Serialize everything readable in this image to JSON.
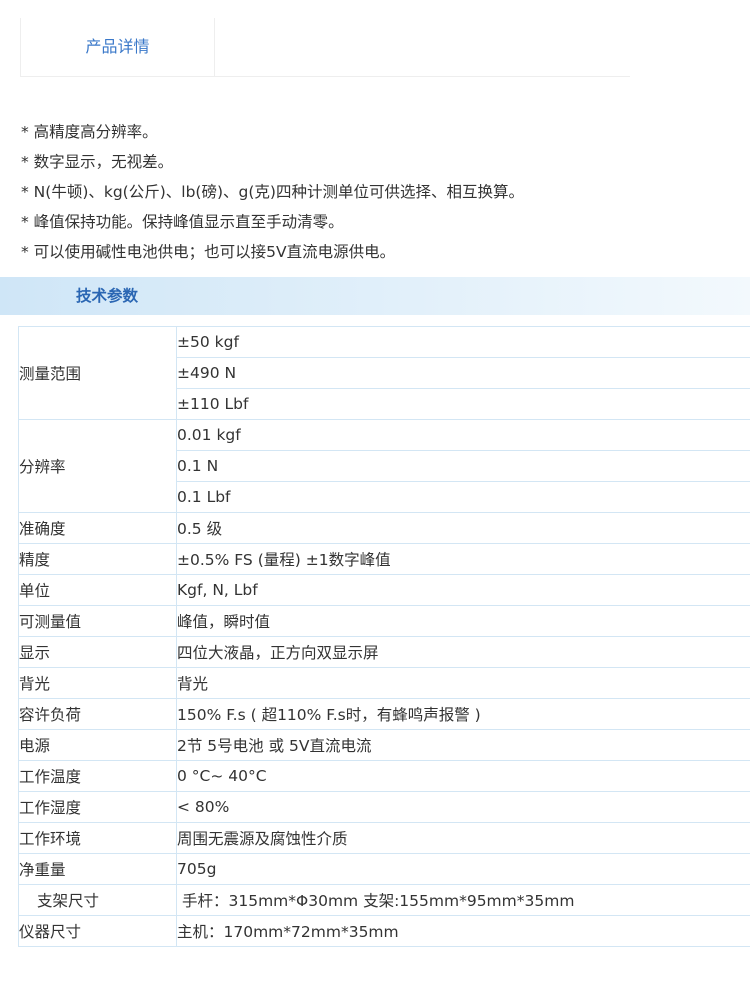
{
  "tabs": {
    "active_label": "产品详情"
  },
  "features": [
    "* 高精度高分辨率。",
    "* 数字显示，无视差。",
    "* N(牛顿)、kg(公斤)、lb(磅)、g(克)四种计测单位可供选择、相互换算。",
    "* 峰值保持功能。保持峰值显示直至手动清零。",
    "* 可以使用碱性电池供电；也可以接5V直流电源供电。"
  ],
  "section": {
    "title": "技术参数"
  },
  "spec_table": {
    "rows": [
      {
        "key": "测量范围",
        "values": [
          "±50 kgf",
          "±490 N",
          "±110 Lbf"
        ]
      },
      {
        "key": "分辨率",
        "values": [
          "0.01 kgf",
          "0.1 N",
          "0.1 Lbf"
        ]
      },
      {
        "key": "准确度",
        "values": [
          "0.5 级"
        ]
      },
      {
        "key": "精度",
        "values": [
          "±0.5% FS (量程) ±1数字峰值"
        ]
      },
      {
        "key": "单位",
        "values": [
          "Kgf, N, Lbf"
        ]
      },
      {
        "key": "可测量值",
        "values": [
          "峰值，瞬时值"
        ]
      },
      {
        "key": "显示",
        "values": [
          "四位大液晶，正方向双显示屏"
        ]
      },
      {
        "key": "背光",
        "values": [
          "背光"
        ]
      },
      {
        "key": "容许负荷",
        "values": [
          "150% F.s ( 超110% F.s时，有蜂鸣声报警 )"
        ]
      },
      {
        "key": "电源",
        "values": [
          "2节 5号电池 或 5V直流电流"
        ]
      },
      {
        "key": "工作温度",
        "values": [
          "0 °C~ 40°C"
        ]
      },
      {
        "key": "工作湿度",
        "values": [
          "< 80%"
        ]
      },
      {
        "key": "工作环境",
        "values": [
          "周围无震源及腐蚀性介质"
        ]
      },
      {
        "key": "净重量",
        "values": [
          "705g"
        ]
      },
      {
        "key": "支架尺寸",
        "values": [
          "手杆：315mm*Φ30mm   支架:155mm*95mm*35mm"
        ]
      },
      {
        "key": "仪器尺寸",
        "values": [
          "主机：170mm*72mm*35mm"
        ]
      }
    ]
  }
}
